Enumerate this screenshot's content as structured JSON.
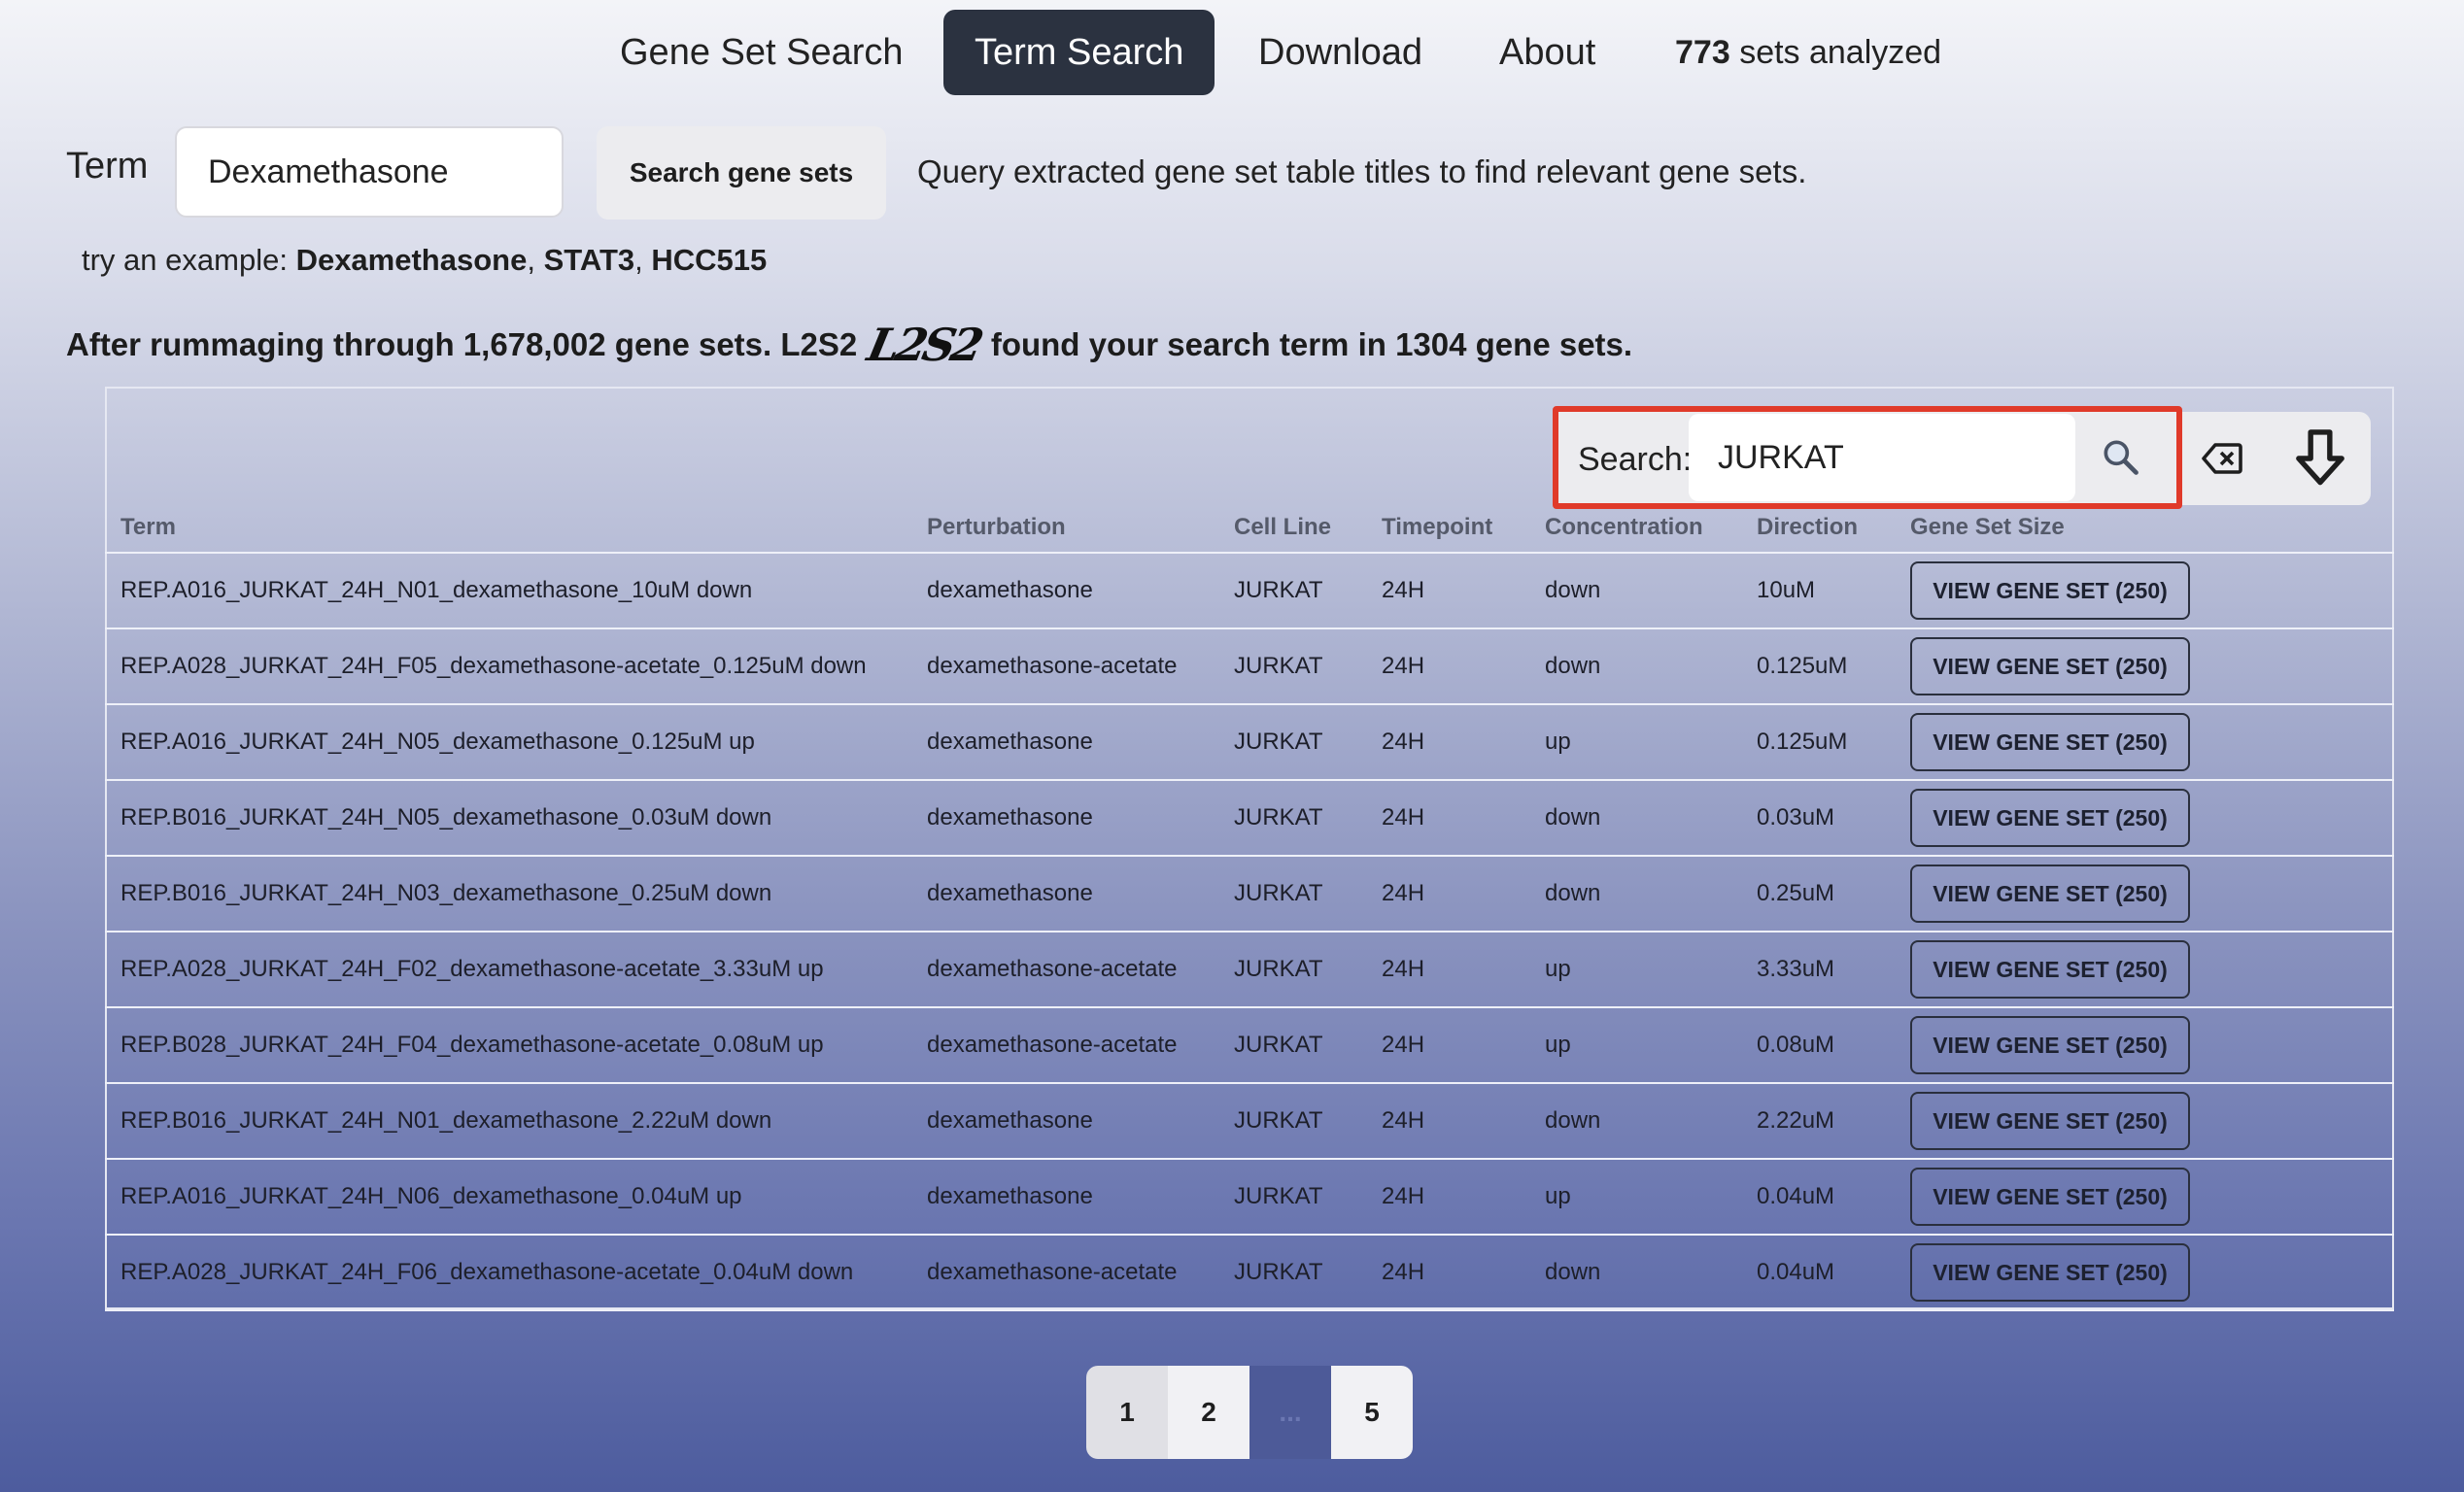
{
  "nav": {
    "items": [
      {
        "label": "Gene Set Search"
      },
      {
        "label": "Term Search"
      },
      {
        "label": "Download"
      },
      {
        "label": "About"
      }
    ],
    "count_value": "773",
    "count_suffix": "sets analyzed"
  },
  "term": {
    "label": "Term",
    "value": "Dexamethasone",
    "button_label": "Search gene sets",
    "help_text": "Query extracted gene set table titles to find relevant gene sets."
  },
  "examples": {
    "prefix": "try an example:",
    "items": [
      "Dexamethasone",
      "STAT3",
      "HCC515"
    ]
  },
  "summary": {
    "before": "After rummaging through 1,678,002 gene sets. L2S2",
    "logo": "L2S2",
    "after": "found your search term in 1304 gene sets."
  },
  "table_search": {
    "label": "Search:",
    "value": "JURKAT"
  },
  "table": {
    "headers": [
      "Term",
      "Perturbation",
      "Cell Line",
      "Timepoint",
      "Concentration",
      "Direction",
      "Gene Set Size"
    ],
    "rows": [
      {
        "term": "REP.A016_JURKAT_24H_N01_dexamethasone_10uM down",
        "perturbation": "dexamethasone",
        "cell_line": "JURKAT",
        "timepoint": "24H",
        "concentration": "down",
        "direction": "10uM",
        "button": "VIEW GENE SET (250)"
      },
      {
        "term": "REP.A028_JURKAT_24H_F05_dexamethasone-acetate_0.125uM down",
        "perturbation": "dexamethasone-acetate",
        "cell_line": "JURKAT",
        "timepoint": "24H",
        "concentration": "down",
        "direction": "0.125uM",
        "button": "VIEW GENE SET (250)"
      },
      {
        "term": "REP.A016_JURKAT_24H_N05_dexamethasone_0.125uM up",
        "perturbation": "dexamethasone",
        "cell_line": "JURKAT",
        "timepoint": "24H",
        "concentration": "up",
        "direction": "0.125uM",
        "button": "VIEW GENE SET (250)"
      },
      {
        "term": "REP.B016_JURKAT_24H_N05_dexamethasone_0.03uM down",
        "perturbation": "dexamethasone",
        "cell_line": "JURKAT",
        "timepoint": "24H",
        "concentration": "down",
        "direction": "0.03uM",
        "button": "VIEW GENE SET (250)"
      },
      {
        "term": "REP.B016_JURKAT_24H_N03_dexamethasone_0.25uM down",
        "perturbation": "dexamethasone",
        "cell_line": "JURKAT",
        "timepoint": "24H",
        "concentration": "down",
        "direction": "0.25uM",
        "button": "VIEW GENE SET (250)"
      },
      {
        "term": "REP.A028_JURKAT_24H_F02_dexamethasone-acetate_3.33uM up",
        "perturbation": "dexamethasone-acetate",
        "cell_line": "JURKAT",
        "timepoint": "24H",
        "concentration": "up",
        "direction": "3.33uM",
        "button": "VIEW GENE SET (250)"
      },
      {
        "term": "REP.B028_JURKAT_24H_F04_dexamethasone-acetate_0.08uM up",
        "perturbation": "dexamethasone-acetate",
        "cell_line": "JURKAT",
        "timepoint": "24H",
        "concentration": "up",
        "direction": "0.08uM",
        "button": "VIEW GENE SET (250)"
      },
      {
        "term": "REP.B016_JURKAT_24H_N01_dexamethasone_2.22uM down",
        "perturbation": "dexamethasone",
        "cell_line": "JURKAT",
        "timepoint": "24H",
        "concentration": "down",
        "direction": "2.22uM",
        "button": "VIEW GENE SET (250)"
      },
      {
        "term": "REP.A016_JURKAT_24H_N06_dexamethasone_0.04uM up",
        "perturbation": "dexamethasone",
        "cell_line": "JURKAT",
        "timepoint": "24H",
        "concentration": "up",
        "direction": "0.04uM",
        "button": "VIEW GENE SET (250)"
      },
      {
        "term": "REP.A028_JURKAT_24H_F06_dexamethasone-acetate_0.04uM down",
        "perturbation": "dexamethasone-acetate",
        "cell_line": "JURKAT",
        "timepoint": "24H",
        "concentration": "down",
        "direction": "0.04uM",
        "button": "VIEW GENE SET (250)"
      }
    ]
  },
  "pagination": {
    "pages": [
      "1",
      "2",
      "...",
      "5"
    ],
    "current": "1"
  },
  "colors": {
    "active_nav": "#2b3240",
    "highlight_border": "#e03a2a"
  },
  "icons": {
    "search": "magnifier-icon",
    "clear": "backspace-icon",
    "download": "download-arrow-icon"
  }
}
